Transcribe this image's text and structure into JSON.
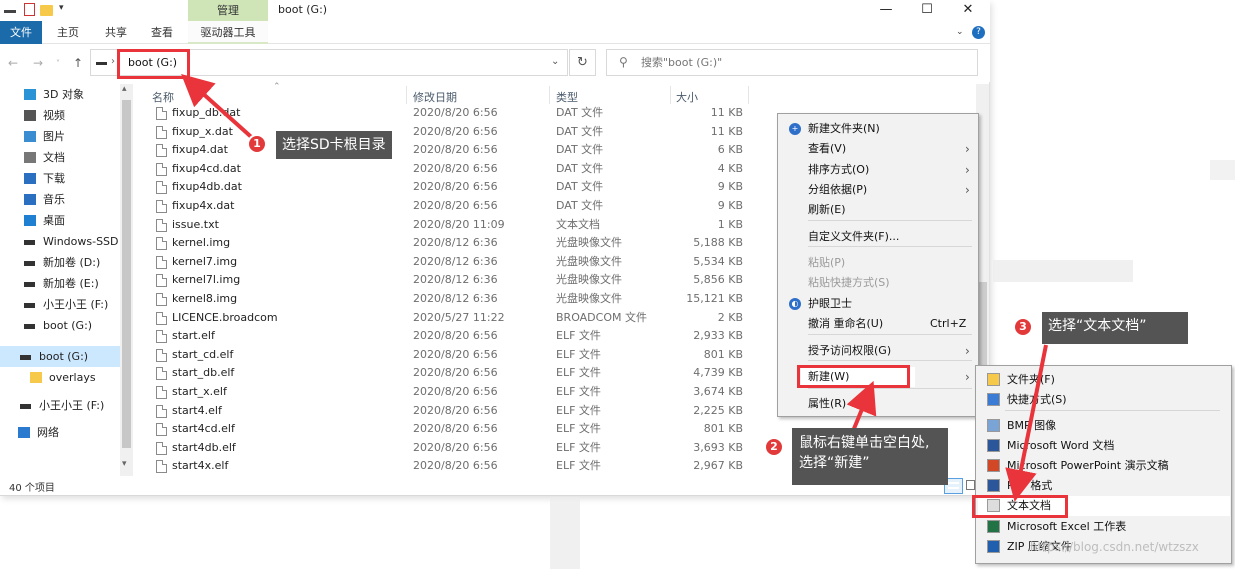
{
  "window": {
    "title": "boot (G:)",
    "contextual_tab": "管理",
    "controls": {
      "minimize": "—",
      "maximize": "☐",
      "close": "✕"
    }
  },
  "ribbon": {
    "tabs": [
      "文件",
      "主页",
      "共享",
      "查看",
      "驱动器工具"
    ],
    "collapse": "⌄",
    "help": "?"
  },
  "navigation": {
    "back": "←",
    "forward": "→",
    "recent": "˅",
    "up": "↑",
    "address": "boot (G:)",
    "address_separator": "›",
    "address_dropdown": "⌄",
    "refresh": "↻",
    "search_placeholder": "搜索\"boot (G:)\"",
    "search_icon": "⚲"
  },
  "sidebar": {
    "items": [
      {
        "label": "3D 对象",
        "icon": "3d-objects-icon"
      },
      {
        "label": "视频",
        "icon": "video-icon"
      },
      {
        "label": "图片",
        "icon": "pictures-icon"
      },
      {
        "label": "文档",
        "icon": "documents-icon"
      },
      {
        "label": "下载",
        "icon": "downloads-icon"
      },
      {
        "label": "音乐",
        "icon": "music-icon"
      },
      {
        "label": "桌面",
        "icon": "desktop-icon"
      },
      {
        "label": "Windows-SSD",
        "icon": "drive-icon"
      },
      {
        "label": "新加卷 (D:)",
        "icon": "drive-icon"
      },
      {
        "label": "新加卷 (E:)",
        "icon": "drive-icon"
      },
      {
        "label": "小王小王 (F:)",
        "icon": "drive-icon"
      },
      {
        "label": "boot (G:)",
        "icon": "drive-icon"
      },
      {
        "label": "boot (G:)",
        "icon": "drive-icon"
      },
      {
        "label": "overlays",
        "icon": "folder-icon"
      },
      {
        "label": "小王小王 (F:)",
        "icon": "drive-icon"
      },
      {
        "label": "网络",
        "icon": "network-icon"
      }
    ]
  },
  "columns": {
    "name": "名称",
    "date": "修改日期",
    "type": "类型",
    "size": "大小"
  },
  "files": [
    {
      "name": "fixup_db.dat",
      "date": "2020/8/20 6:56",
      "type": "DAT 文件",
      "size": "11 KB"
    },
    {
      "name": "fixup_x.dat",
      "date": "2020/8/20 6:56",
      "type": "DAT 文件",
      "size": "11 KB"
    },
    {
      "name": "fixup4.dat",
      "date": "2020/8/20 6:56",
      "type": "DAT 文件",
      "size": "6 KB"
    },
    {
      "name": "fixup4cd.dat",
      "date": "2020/8/20 6:56",
      "type": "DAT 文件",
      "size": "4 KB"
    },
    {
      "name": "fixup4db.dat",
      "date": "2020/8/20 6:56",
      "type": "DAT 文件",
      "size": "9 KB"
    },
    {
      "name": "fixup4x.dat",
      "date": "2020/8/20 6:56",
      "type": "DAT 文件",
      "size": "9 KB"
    },
    {
      "name": "issue.txt",
      "date": "2020/8/20 11:09",
      "type": "文本文档",
      "size": "1 KB"
    },
    {
      "name": "kernel.img",
      "date": "2020/8/12 6:36",
      "type": "光盘映像文件",
      "size": "5,188 KB"
    },
    {
      "name": "kernel7.img",
      "date": "2020/8/12 6:36",
      "type": "光盘映像文件",
      "size": "5,534 KB"
    },
    {
      "name": "kernel7l.img",
      "date": "2020/8/12 6:36",
      "type": "光盘映像文件",
      "size": "5,856 KB"
    },
    {
      "name": "kernel8.img",
      "date": "2020/8/12 6:36",
      "type": "光盘映像文件",
      "size": "15,121 KB"
    },
    {
      "name": "LICENCE.broadcom",
      "date": "2020/5/27 11:22",
      "type": "BROADCOM 文件",
      "size": "2 KB"
    },
    {
      "name": "start.elf",
      "date": "2020/8/20 6:56",
      "type": "ELF 文件",
      "size": "2,933 KB"
    },
    {
      "name": "start_cd.elf",
      "date": "2020/8/20 6:56",
      "type": "ELF 文件",
      "size": "801 KB"
    },
    {
      "name": "start_db.elf",
      "date": "2020/8/20 6:56",
      "type": "ELF 文件",
      "size": "4,739 KB"
    },
    {
      "name": "start_x.elf",
      "date": "2020/8/20 6:56",
      "type": "ELF 文件",
      "size": "3,674 KB"
    },
    {
      "name": "start4.elf",
      "date": "2020/8/20 6:56",
      "type": "ELF 文件",
      "size": "2,225 KB"
    },
    {
      "name": "start4cd.elf",
      "date": "2020/8/20 6:56",
      "type": "ELF 文件",
      "size": "801 KB"
    },
    {
      "name": "start4db.elf",
      "date": "2020/8/20 6:56",
      "type": "ELF 文件",
      "size": "3,693 KB"
    },
    {
      "name": "start4x.elf",
      "date": "2020/8/20 6:56",
      "type": "ELF 文件",
      "size": "2,967 KB"
    }
  ],
  "status": {
    "count": "40 个项目"
  },
  "context_menu": {
    "items": [
      {
        "label": "新建文件夹(N)",
        "icon": "new-folder-icon"
      },
      {
        "label": "查看(V)",
        "submenu": true
      },
      {
        "label": "排序方式(O)",
        "submenu": true
      },
      {
        "label": "分组依据(P)",
        "submenu": true
      },
      {
        "label": "刷新(E)"
      },
      {
        "label": "自定义文件夹(F)..."
      },
      {
        "label": "粘贴(P)",
        "disabled": true
      },
      {
        "label": "粘贴快捷方式(S)",
        "disabled": true
      },
      {
        "label": "护眼卫士",
        "icon": "eye-guard-icon"
      },
      {
        "label": "撤消 重命名(U)",
        "shortcut": "Ctrl+Z"
      },
      {
        "label": "授予访问权限(G)",
        "submenu": true
      },
      {
        "label": "新建(W)",
        "submenu": true
      },
      {
        "label": "属性(R)"
      }
    ],
    "submenu_arrow": "›"
  },
  "new_submenu": {
    "items": [
      {
        "label": "文件夹(F)",
        "icon": "folder-icon"
      },
      {
        "label": "快捷方式(S)",
        "icon": "shortcut-icon"
      },
      {
        "label": "BMP 图像",
        "icon": "bmp-icon"
      },
      {
        "label": "Microsoft Word 文档",
        "icon": "word-icon"
      },
      {
        "label": "Microsoft PowerPoint 演示文稿",
        "icon": "powerpoint-icon"
      },
      {
        "label": "RTF 格式",
        "icon": "rtf-icon"
      },
      {
        "label": "文本文档",
        "icon": "text-document-icon"
      },
      {
        "label": "Microsoft Excel 工作表",
        "icon": "excel-icon"
      },
      {
        "label": "ZIP 压缩文件",
        "icon": "zip-icon"
      }
    ]
  },
  "annotations": [
    {
      "number": "1",
      "text": "选择SD卡根目录"
    },
    {
      "number": "2",
      "text_line1": "鼠标右键单击空白处,",
      "text_line2": "选择“新建”"
    },
    {
      "number": "3",
      "text": "选择“文本文档”"
    }
  ],
  "watermark": "https://blog.csdn.net/wtzszx",
  "colors": {
    "annotation_red": "#e8343a",
    "callout_bg": "#545454",
    "file_tab": "#1b6aa9",
    "manage_tab": "#cfe5b8",
    "selection": "#cce8ff"
  }
}
